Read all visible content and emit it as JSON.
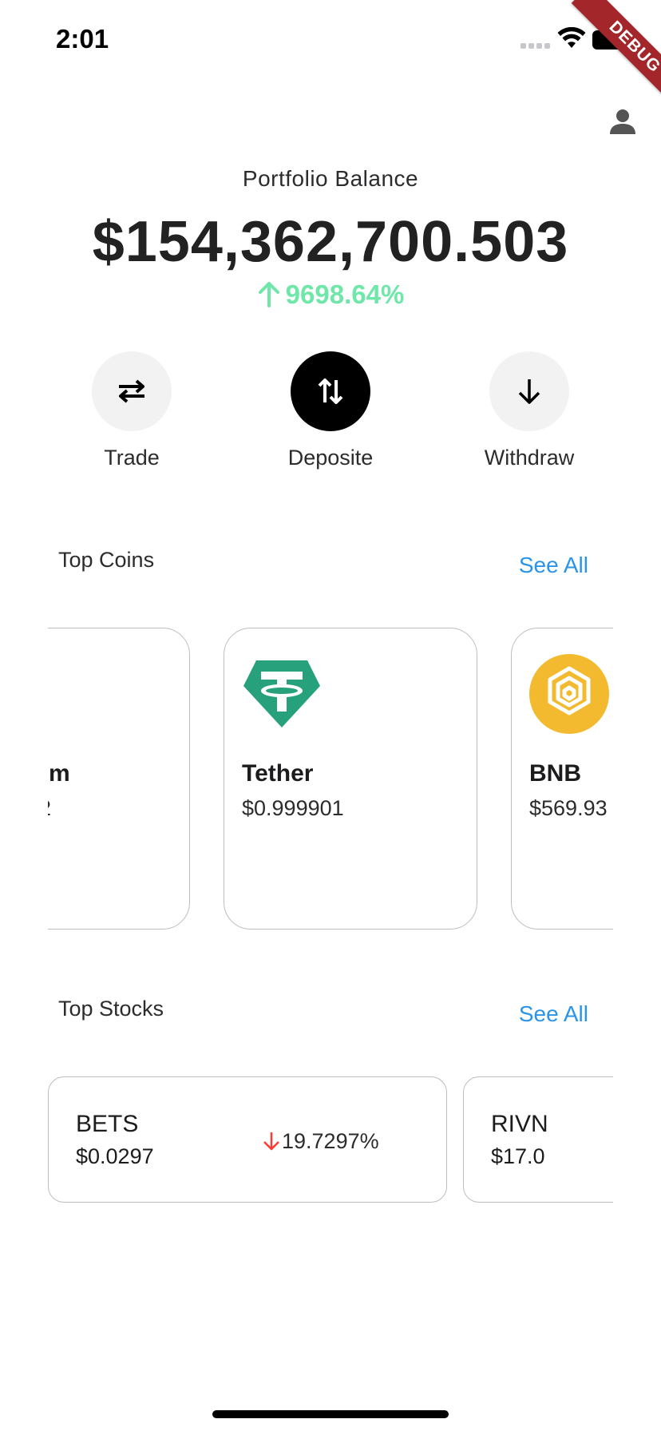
{
  "status_bar": {
    "time": "2:01"
  },
  "debug_banner": "DEBUG",
  "portfolio": {
    "title": "Portfolio Balance",
    "balance": "$154,362,700.503",
    "change": "9698.64%",
    "change_direction": "up",
    "change_color": "#6ee7a8"
  },
  "actions": [
    {
      "label": "Trade",
      "icon": "swap-arrows-icon"
    },
    {
      "label": "Deposite",
      "icon": "up-down-arrows-icon",
      "active": true
    },
    {
      "label": "Withdraw",
      "icon": "arrow-down-icon"
    }
  ],
  "top_coins": {
    "title": "Top Coins",
    "see_all": "See All",
    "coins": [
      {
        "name": "m",
        "price": "2",
        "partial": true
      },
      {
        "name": "Tether",
        "price": "$0.999901",
        "icon": "tether-logo",
        "color": "#26a17b"
      },
      {
        "name": "BNB",
        "price": "$569.93",
        "icon": "bnb-logo",
        "color": "#f3ba2f"
      }
    ]
  },
  "top_stocks": {
    "title": "Top Stocks",
    "see_all": "See All",
    "stocks": [
      {
        "symbol": "BETS",
        "price": "$0.0297",
        "change": "19.7297%",
        "direction": "down",
        "direction_color": "#ff3b30"
      },
      {
        "symbol": "RIVN",
        "price": "$17.0"
      }
    ]
  },
  "colors": {
    "accent_link": "#2a95e6",
    "card_border": "#bdbdbd"
  }
}
